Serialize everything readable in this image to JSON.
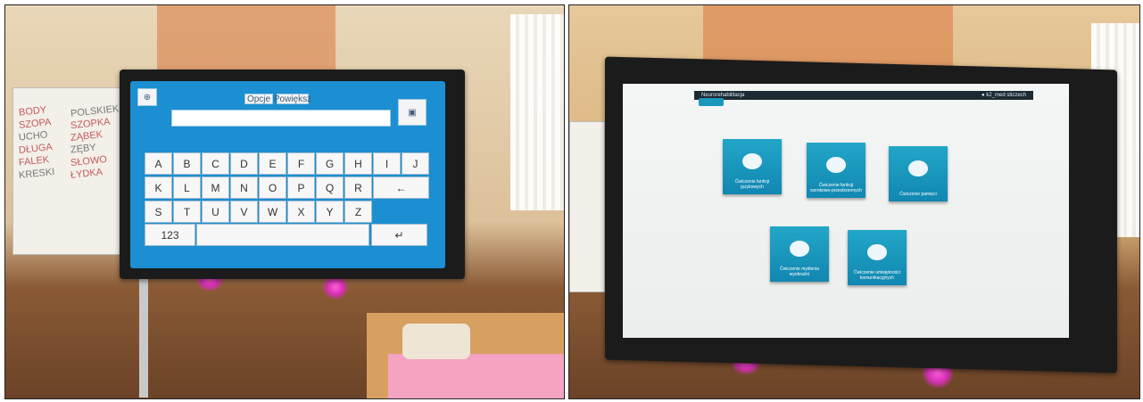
{
  "left_photo": {
    "keyboard_screen": {
      "top_buttons": [
        "Opcje",
        "Powiększ"
      ],
      "rows": [
        [
          "A",
          "B",
          "C",
          "D",
          "E",
          "F",
          "G",
          "H",
          "I",
          "J"
        ],
        [
          "K",
          "L",
          "M",
          "N",
          "O",
          "P",
          "Q",
          "R",
          "←"
        ],
        [
          "S",
          "T",
          "U",
          "V",
          "W",
          "X",
          "Y",
          "Z"
        ],
        [
          "123",
          "↵"
        ]
      ]
    },
    "flipchart_words": [
      "BODY",
      "POLSKIEK",
      "SZOPA",
      "SZOPKA",
      "UCHO",
      "ZĄBEK",
      "DŁUGA",
      "ZĘBY",
      "FALEK",
      "SŁOWO",
      "KRESKI",
      "ŁYDKA"
    ]
  },
  "right_photo": {
    "app_screen": {
      "app_title": "Neurorehabilitacja",
      "user": "k2_med sticzech",
      "tiles": [
        {
          "label": "Ćwiczenie funkcji językowych"
        },
        {
          "label": "Ćwiczenie funkcji wzrokowo-przestrzennych"
        },
        {
          "label": "Ćwiczenie pamięci"
        },
        {
          "label": "Ćwiczenie myślenia wyobraźni"
        },
        {
          "label": "Ćwiczenie umiejętności komunikacyjnych"
        }
      ]
    }
  },
  "colors": {
    "keyboard_screen_bg": "#1b8fd1",
    "tile_bg": "#1a97bf",
    "led_glow": "#e23cc0"
  }
}
